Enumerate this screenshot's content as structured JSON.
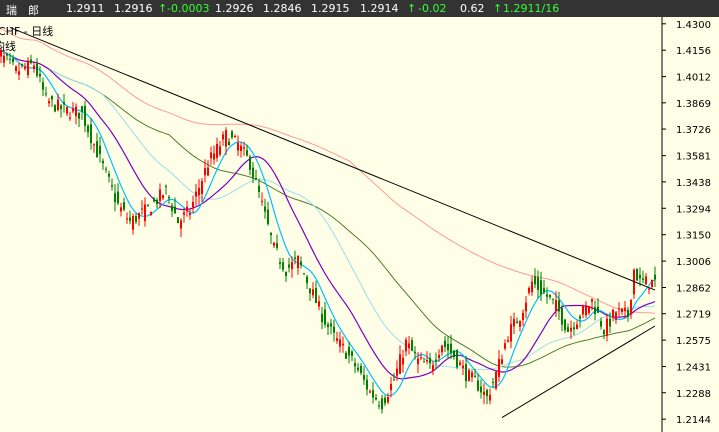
{
  "header": {
    "symbol": "瑞　郎",
    "open": "1.2911",
    "high": "1.2916",
    "change": "-0.0003",
    "v1": "1.2926",
    "v2": "1.2846",
    "v3": "1.2915",
    "v4": "1.2914",
    "change2": "-0.02",
    "change2_pct": "0.62",
    "ratio": "1.2911/16",
    "up_arrow": "↑"
  },
  "chart_title": "CHF - 日线",
  "chart_subtitle": "均线",
  "colors": {
    "background": "#ffffe8",
    "up_candle": "#ff0000",
    "down_candle": "#008000",
    "ma_blue": "#00bfff",
    "ma_purple": "#8000c0",
    "ma_green": "#4e7d2f",
    "ma_pink": "#ff9999",
    "ma_lightblue": "#99ddee",
    "trendline": "#000000"
  },
  "chart_data": {
    "type": "candlestick",
    "y_ticks": [
      "1.4300",
      "1.4156",
      "1.4012",
      "1.3869",
      "1.3726",
      "1.3581",
      "1.3438",
      "1.3294",
      "1.3150",
      "1.3006",
      "1.2862",
      "1.2719",
      "1.2575",
      "1.2431",
      "1.2288",
      "1.2144"
    ],
    "ylim": [
      1.2074,
      1.4337
    ],
    "close_anchors": [
      [
        0,
        1.418
      ],
      [
        8,
        1.404
      ],
      [
        14,
        1.408
      ],
      [
        18,
        1.388
      ],
      [
        24,
        1.383
      ],
      [
        30,
        1.381
      ],
      [
        36,
        1.356
      ],
      [
        42,
        1.331
      ],
      [
        46,
        1.322
      ],
      [
        52,
        1.329
      ],
      [
        58,
        1.339
      ],
      [
        62,
        1.322
      ],
      [
        66,
        1.328
      ],
      [
        72,
        1.354
      ],
      [
        78,
        1.369
      ],
      [
        82,
        1.364
      ],
      [
        86,
        1.354
      ],
      [
        90,
        1.331
      ],
      [
        94,
        1.307
      ],
      [
        98,
        1.296
      ],
      [
        102,
        1.301
      ],
      [
        106,
        1.286
      ],
      [
        110,
        1.271
      ],
      [
        114,
        1.259
      ],
      [
        118,
        1.251
      ],
      [
        122,
        1.241
      ],
      [
        126,
        1.229
      ],
      [
        130,
        1.223
      ],
      [
        134,
        1.236
      ],
      [
        138,
        1.256
      ],
      [
        142,
        1.246
      ],
      [
        146,
        1.243
      ],
      [
        150,
        1.256
      ],
      [
        154,
        1.249
      ],
      [
        158,
        1.239
      ],
      [
        162,
        1.233
      ],
      [
        165,
        1.226
      ],
      [
        168,
        1.239
      ],
      [
        172,
        1.261
      ],
      [
        176,
        1.271
      ],
      [
        180,
        1.289
      ],
      [
        184,
        1.283
      ],
      [
        188,
        1.276
      ],
      [
        192,
        1.263
      ],
      [
        196,
        1.271
      ],
      [
        200,
        1.279
      ],
      [
        204,
        1.263
      ],
      [
        208,
        1.273
      ],
      [
        212,
        1.271
      ],
      [
        214,
        1.296
      ],
      [
        216,
        1.289
      ]
    ],
    "moving_averages": [
      "ma_blue",
      "ma_purple",
      "ma_green",
      "ma_pink",
      "ma_lightblue"
    ],
    "trendlines": [
      {
        "from": [
          6,
          1.428
        ],
        "to": [
          221,
          1.2848
        ]
      },
      {
        "from": [
          170,
          1.2153
        ],
        "to": [
          221,
          1.2652
        ]
      }
    ]
  }
}
